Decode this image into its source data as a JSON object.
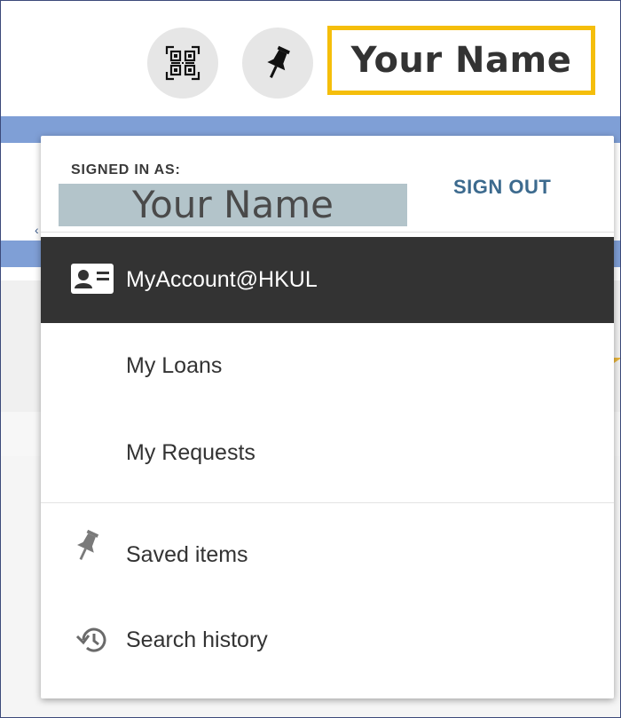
{
  "header": {
    "user_name": "Your Name",
    "qr_icon": "qr-code-icon",
    "pin_icon": "pin-icon",
    "highlight_color": "#f5be0b"
  },
  "dropdown": {
    "signed_in_label": "SIGNED IN AS:",
    "user_name": "Your Name",
    "sign_out_label": "SIGN OUT",
    "account_item": {
      "label": "MyAccount@HKUL",
      "icon": "id-card-icon"
    },
    "account_sub_items": [
      {
        "label": "My Loans"
      },
      {
        "label": "My Requests"
      }
    ],
    "tools": [
      {
        "label": "Saved items",
        "icon": "pin-icon"
      },
      {
        "label": "Search history",
        "icon": "history-icon"
      }
    ]
  },
  "colors": {
    "accent_blue": "#7f9fd6",
    "sign_out": "#3c6a8e",
    "active_row": "#333333",
    "name_mask": "#b3c4ca"
  }
}
